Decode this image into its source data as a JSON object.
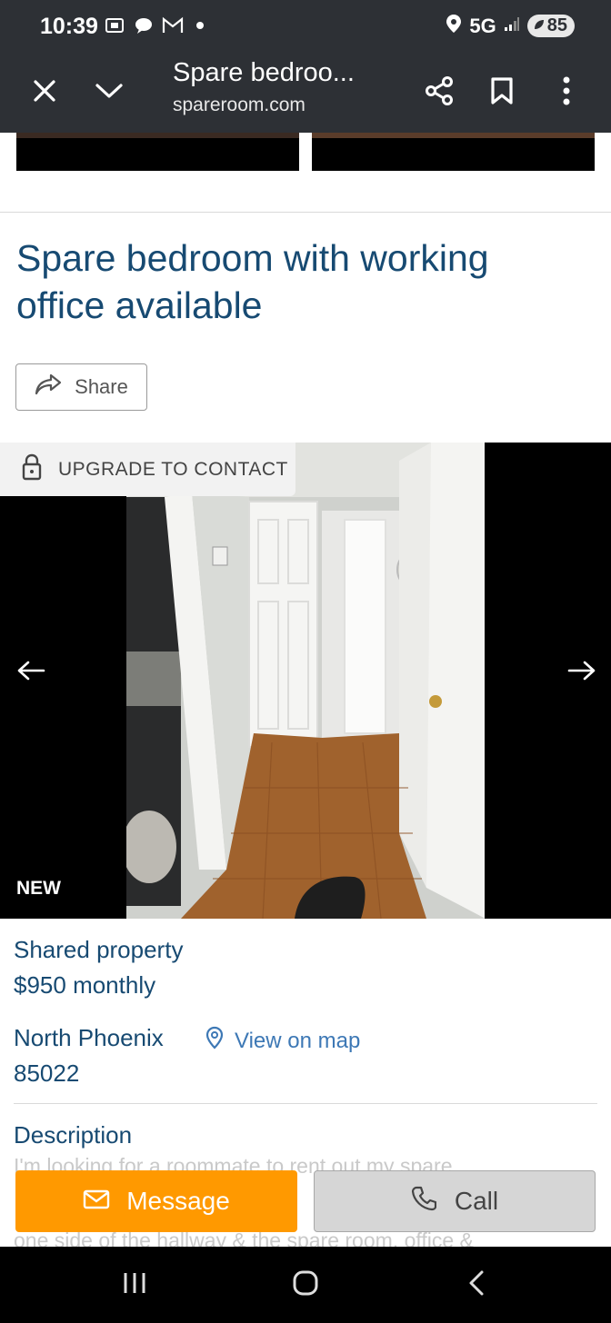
{
  "status_bar": {
    "time": "10:39",
    "network": "5G",
    "battery": "85"
  },
  "browser": {
    "page_title": "Spare bedroo...",
    "url": "spareroom.com"
  },
  "listing": {
    "title": "Spare bedroom with working office available",
    "share_label": "Share",
    "upgrade_label": "UPGRADE TO CONTACT",
    "new_badge": "NEW",
    "property_type": "Shared property",
    "price": "$950 monthly",
    "area": "North Phoenix",
    "zip": "85022",
    "view_on_map": "View on map",
    "description_heading": "Description",
    "description_line1": "I'm looking for a roommate to rent out my spare",
    "description_line2": "one side of the hallway & the spare room, office &"
  },
  "actions": {
    "message_label": "Message",
    "call_label": "Call"
  },
  "colors": {
    "brand_blue": "#174a72",
    "link_blue": "#3d78b5",
    "message_orange": "#ff9900"
  }
}
